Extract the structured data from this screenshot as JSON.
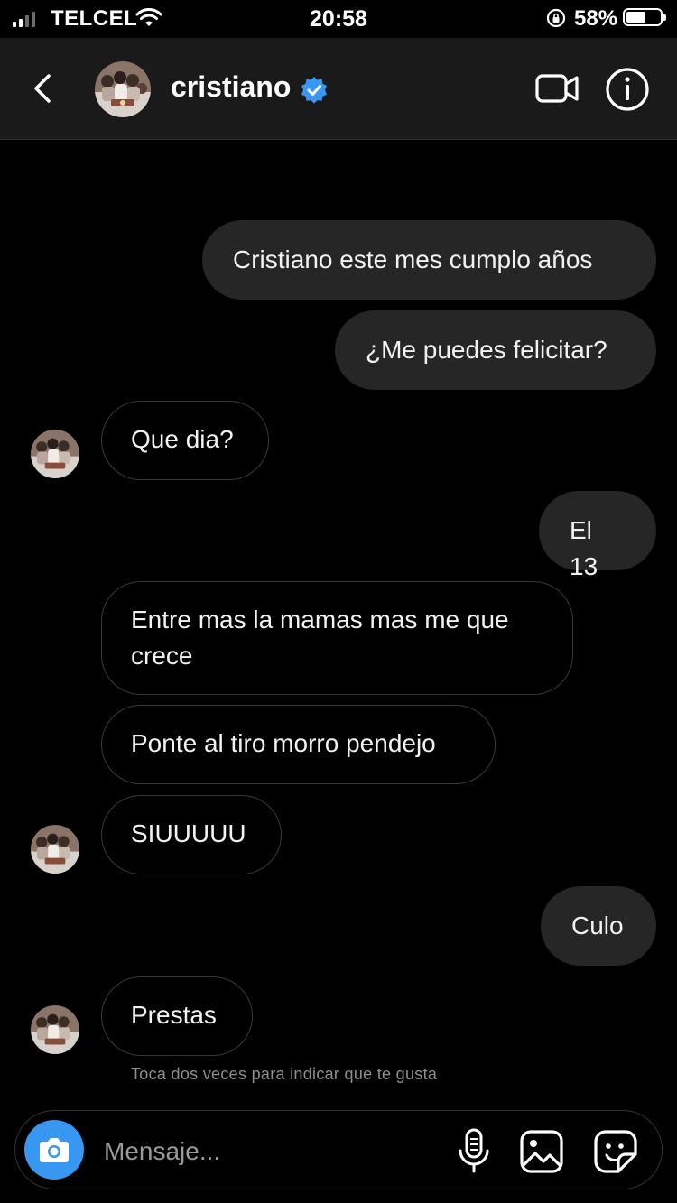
{
  "status_bar": {
    "carrier": "TELCEL",
    "time": "20:58",
    "battery_percent": "58%",
    "battery_level": 0.58
  },
  "header": {
    "contact_name": "cristiano",
    "verified": true,
    "icons": [
      "back-arrow-icon",
      "verified-badge-icon",
      "video-call-icon",
      "info-icon"
    ]
  },
  "messages": [
    {
      "side": "sent",
      "text": "Cristiano este mes cumplo años"
    },
    {
      "side": "sent",
      "text": "¿Me puedes felicitar?"
    },
    {
      "side": "received",
      "text": "Que dia?"
    },
    {
      "side": "sent",
      "text": "El 13"
    },
    {
      "side": "received",
      "text": "Entre mas la mamas mas me que crece"
    },
    {
      "side": "received",
      "text": "Ponte al tiro morro pendejo"
    },
    {
      "side": "received",
      "text": "SIUUUUU"
    },
    {
      "side": "sent",
      "text": "Culo"
    },
    {
      "side": "received",
      "text": "Prestas"
    }
  ],
  "hint": "Toca dos veces para indicar que te gusta",
  "composer": {
    "placeholder": "Mensaje...",
    "icons": [
      "camera-icon",
      "microphone-icon",
      "gallery-icon",
      "sticker-icon"
    ]
  },
  "colors": {
    "background": "#000000",
    "header": "#1a1a1a",
    "sent_bubble": "#262626",
    "received_border": "#3a3a3a",
    "accent_blue": "#3897f0"
  }
}
